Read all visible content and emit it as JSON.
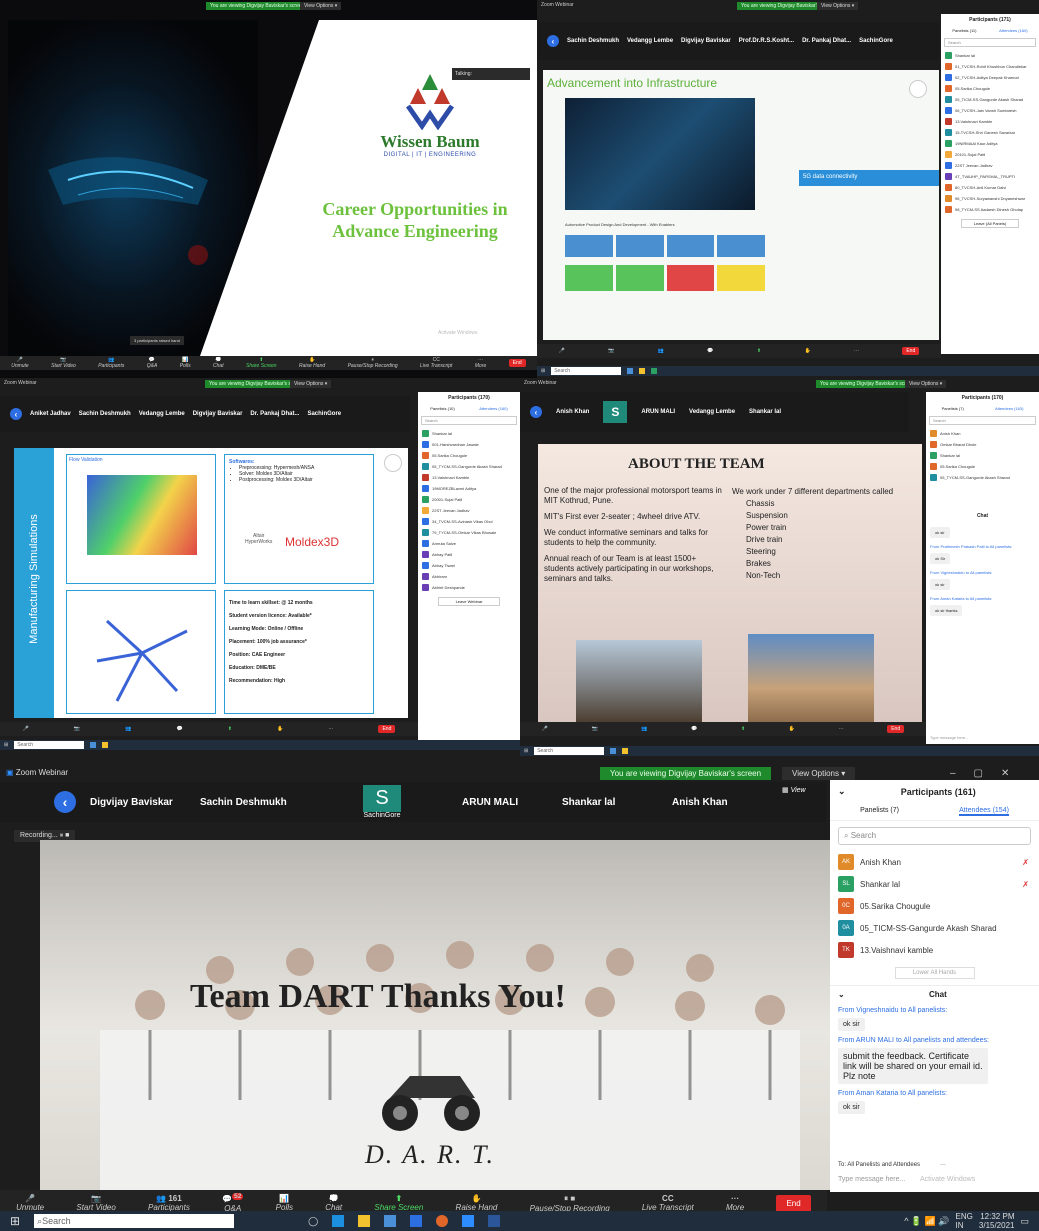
{
  "zoom": {
    "title": "Zoom Webinar",
    "viewing": "You are viewing Digvijay Baviskar's screen",
    "view_options": "View Options ▾",
    "view": "View",
    "toolbar": [
      "Unmute",
      "Start Video",
      "Participants",
      "Q&A",
      "Polls",
      "Chat",
      "Share Screen",
      "Raise Hand",
      "Pause/Stop Recording",
      "Live Transcript",
      "More"
    ],
    "end": "End",
    "recording": "Recording...",
    "qa_count": "52",
    "participants_count": "161"
  },
  "taskbar": {
    "search": "Search",
    "lang": "ENG",
    "region": "IN",
    "time": "12:32 PM",
    "date": "3/15/2021"
  },
  "s1": {
    "logo_brand": "Wissen Baum",
    "logo_sub": "DIGITAL | IT | ENGINEERING",
    "heading": "Career Opportunities in Advance Engineering",
    "talking": "Talking:",
    "saved": "3 participants raised hand",
    "watermark": "Activate Windows"
  },
  "s2": {
    "names": [
      "Sachin Deshmukh",
      "Vedangg Lembe",
      "Digvijay Baviskar",
      "Prof.Dr.R.S.Kosht...",
      "Dr. Pankaj Dhat...",
      "SachinGore"
    ],
    "title": "Advancement into Infrastructure",
    "tag": "5G data connectivity",
    "caption": "Automotive Product Design And Development - With Enablers",
    "panel_title": "Participants (171)",
    "tabs": [
      "Panelists (11)",
      "Attendees (160)"
    ],
    "search": "Search",
    "list": [
      "Shankar lal",
      "01_TVCSH-Rohit Khushbun Chandlekar",
      "02_TVCSH-Aditya Deepak Kharmal",
      "05.Sarika Chougule",
      "05_TICM-SS-Gangurde Akash Sharad",
      "06_TVCSH-Jain Vansh Sumtaresh",
      "13.Vaishnavi Kamble",
      "15-TVCSH-Shri Ganesh Savarkar",
      "19NIRMAAl Kaur Aditya",
      "20101-Sujal Patil",
      "22ST Jeevan Jadhav",
      "4T_TVAUHP_PARSHAL_TRUPTI",
      "80_TVCSH-Anil Kumar Dalvi",
      "96_TVCSH-Suryawanshi Dnyaneshwar",
      "98_TYCM-SS Aadarsh Dinesh Gholap"
    ],
    "leave": "Leave (All Panels)"
  },
  "s3": {
    "names": [
      "Aniket Jadhav",
      "Sachin Deshmukh",
      "Vedangg Lembe",
      "Digvijay Baviskar",
      "Dr. Pankaj Dhat...",
      "SachinGore"
    ],
    "side_title": "Manufacturing Simulations",
    "flow": "Flow Validation",
    "software_title": "Softwares:",
    "software": [
      "Preprocessing: Hypermesh/ANSA",
      "Solver: Moldex 3D/Altair",
      "Postprocessing: Moldex 3D/Altair"
    ],
    "altair": "Altair",
    "hyperworks": "HyperWorks",
    "moldex": "Moldex3D",
    "facts": [
      "Time to learn skillset: @ 12 months",
      "Student version licence: Available*",
      "Learning Mode: Online / Offline",
      "Placement: 100% job assurance*",
      "Position: CAE Engineer",
      "Education: DME/BE",
      "Recommendation: High"
    ],
    "panel_title": "Participants (170)",
    "tabs": [
      "Panelists (10)",
      "Attendees (160)"
    ],
    "search": "Search",
    "list": [
      "Shankar lal",
      "001-Harshvardhan Jawale",
      "05.Sarika Chougule",
      "05_TYCM-SS-Gangurde Akash Sharad",
      "13.Vaishnavi Kamble",
      "19MOREZBLaxmi Aditya",
      "20001-Sujal Patil",
      "22ST Jeevan Jadhav",
      "34_TVCM-SS-Avinash Vikas Ohol",
      "79_TYCM-SS-Omkar Vikas Bhosale",
      "Amruta Salve",
      "Abhay Patil",
      "Abhay Tiwari",
      "Abhiram",
      "Abhirit Deshpande"
    ],
    "leave": "Leave Webinar"
  },
  "s4": {
    "names": [
      "Anish Khan",
      "S",
      "ARUN MALI",
      "Vedangg Lembe",
      "Shankar lal"
    ],
    "sub": "SachinGore",
    "dikar": "Omkar Bharat Dhole",
    "heading": "ABOUT THE TEAM",
    "bullets": [
      "One of the major professional motorsport teams in MIT Kothrud, Pune.",
      "MIT's First ever 2-seater ; 4wheel drive ATV.",
      "We conduct informative seminars and talks for students to help the community.",
      "Annual reach of our Team is at least 1500+ students actively participating in our workshops, seminars and talks."
    ],
    "dept_intro": "We work under 7 different departments called",
    "departments": [
      "Chassis",
      "Suspension",
      "Power train",
      "Drive train",
      "Steering",
      "Brakes",
      "Non-Tech"
    ],
    "panel_title": "Participants (170)",
    "tabs": [
      "Panelists (7)",
      "Attendees (163)"
    ],
    "search": "Search",
    "list": [
      "Anish Khan",
      "Omkar Bharat Dhole",
      "Shankar lal",
      "05.Sarika Chougule",
      "05_TYCM-SS-Gangurde Akash Sharad"
    ],
    "chat_title": "Chat",
    "chat": [
      {
        "from": "",
        "text": "ok sir"
      },
      {
        "from": "From Prathmesh Prakash Patil to All panelists:",
        "text": "ok Sir"
      },
      {
        "from": "From Vigneshnaidu to All panelists:",
        "text": "ok sir"
      },
      {
        "from": "From Aman Kataria to All panelists:",
        "text": "ok sir thanks"
      }
    ],
    "compose": "Type message here..."
  },
  "s5": {
    "names": [
      "Digvijay Baviskar",
      "Sachin Deshmukh",
      "S",
      "ARUN MALI",
      "Shankar lal",
      "Anish Khan"
    ],
    "sachin_gore": "SachinGore",
    "thanks": "Team DART Thanks You!",
    "logo": "D. A. R. T.",
    "panel_title": "Participants (161)",
    "tabs": [
      "Panelists (7)",
      "Attendees (154)"
    ],
    "search": "Search",
    "list": [
      {
        "i": "AK",
        "n": "Anish Khan",
        "c": "#e08a2a"
      },
      {
        "i": "SL",
        "n": "Shankar lal",
        "c": "#2aa163"
      },
      {
        "i": "0C",
        "n": "05.Sarika Chougule",
        "c": "#e0662a"
      },
      {
        "i": "0A",
        "n": "05_TICM-SS-Gangurde Akash Sharad",
        "c": "#1f8fa0"
      },
      {
        "i": "TK",
        "n": "13.Vaishnavi kamble",
        "c": "#c0392b"
      }
    ],
    "lower_all": "Lower All Hands",
    "chat_title": "Chat",
    "chat": [
      {
        "from": "From Vigneshnaidu to All panelists:",
        "text": "ok sir"
      },
      {
        "from": "From ARUN MALI to All panelists and attendees:",
        "text": "submit the feedback. Certificate link will be shared on your email id. Plz note"
      },
      {
        "from": "From Aman Kataria to All panelists:",
        "text": "ok sir"
      }
    ],
    "to": "To: All Panelists and Attendees",
    "more": "···",
    "compose": "Type message here...",
    "activate": "Activate Windows"
  }
}
